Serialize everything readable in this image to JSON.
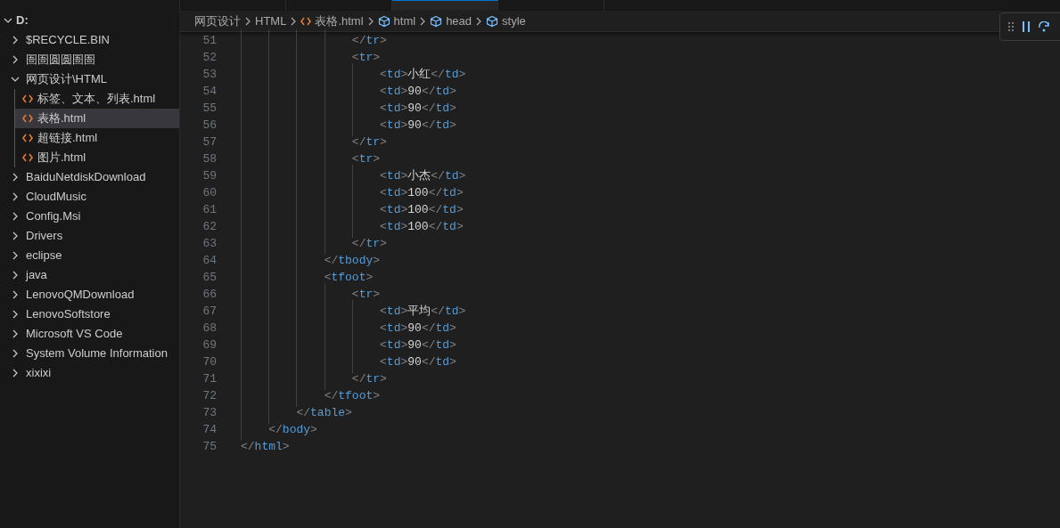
{
  "editor_tabs": [
    {
      "selected": false
    },
    {
      "selected": false
    },
    {
      "selected": true
    },
    {
      "selected": false
    }
  ],
  "explorer": {
    "root": "D:",
    "items": [
      {
        "label": "$RECYCLE.BIN",
        "kind": "folder",
        "expanded": false,
        "selected": false
      },
      {
        "label": "圄圄圆圆圄圄",
        "kind": "folder",
        "expanded": false,
        "selected": false
      },
      {
        "label": "网页设计\\HTML",
        "kind": "folder",
        "expanded": true,
        "selected": false,
        "children": [
          {
            "label": "标签、文本、列表.html",
            "kind": "file",
            "selected": false
          },
          {
            "label": "表格.html",
            "kind": "file",
            "selected": true
          },
          {
            "label": "超链接.html",
            "kind": "file",
            "selected": false
          },
          {
            "label": "图片.html",
            "kind": "file",
            "selected": false
          }
        ]
      },
      {
        "label": "BaiduNetdiskDownload",
        "kind": "folder",
        "expanded": false,
        "selected": false
      },
      {
        "label": "CloudMusic",
        "kind": "folder",
        "expanded": false,
        "selected": false
      },
      {
        "label": "Config.Msi",
        "kind": "folder",
        "expanded": false,
        "selected": false
      },
      {
        "label": "Drivers",
        "kind": "folder",
        "expanded": false,
        "selected": false
      },
      {
        "label": "eclipse",
        "kind": "folder",
        "expanded": false,
        "selected": false
      },
      {
        "label": "java",
        "kind": "folder",
        "expanded": false,
        "selected": false
      },
      {
        "label": "LenovoQMDownload",
        "kind": "folder",
        "expanded": false,
        "selected": false
      },
      {
        "label": "LenovoSoftstore",
        "kind": "folder",
        "expanded": false,
        "selected": false
      },
      {
        "label": "Microsoft VS Code",
        "kind": "folder",
        "expanded": false,
        "selected": false
      },
      {
        "label": "System Volume Information",
        "kind": "folder",
        "expanded": false,
        "selected": false
      },
      {
        "label": "xixixi",
        "kind": "folder",
        "expanded": false,
        "selected": false
      }
    ]
  },
  "breadcrumb": [
    {
      "label": "网页设计",
      "kind": "folder"
    },
    {
      "label": "HTML",
      "kind": "folder"
    },
    {
      "label": "表格.html",
      "kind": "file"
    },
    {
      "label": "html",
      "kind": "element"
    },
    {
      "label": "head",
      "kind": "element"
    },
    {
      "label": "style",
      "kind": "element"
    }
  ],
  "code_lines": [
    {
      "number": "51",
      "text": "                </tr>"
    },
    {
      "number": "52",
      "text": "                <tr>"
    },
    {
      "number": "53",
      "text": "                    <td>小红</td>"
    },
    {
      "number": "54",
      "text": "                    <td>90</td>"
    },
    {
      "number": "55",
      "text": "                    <td>90</td>"
    },
    {
      "number": "56",
      "text": "                    <td>90</td>"
    },
    {
      "number": "57",
      "text": "                </tr>"
    },
    {
      "number": "58",
      "text": "                <tr>"
    },
    {
      "number": "59",
      "text": "                    <td>小杰</td>"
    },
    {
      "number": "60",
      "text": "                    <td>100</td>"
    },
    {
      "number": "61",
      "text": "                    <td>100</td>"
    },
    {
      "number": "62",
      "text": "                    <td>100</td>"
    },
    {
      "number": "63",
      "text": "                </tr>"
    },
    {
      "number": "64",
      "text": "            </tbody>"
    },
    {
      "number": "65",
      "text": "            <tfoot>"
    },
    {
      "number": "66",
      "text": "                <tr>"
    },
    {
      "number": "67",
      "text": "                    <td>平均</td>"
    },
    {
      "number": "68",
      "text": "                    <td>90</td>"
    },
    {
      "number": "69",
      "text": "                    <td>90</td>"
    },
    {
      "number": "70",
      "text": "                    <td>90</td>"
    },
    {
      "number": "71",
      "text": "                </tr>"
    },
    {
      "number": "72",
      "text": "            </tfoot>"
    },
    {
      "number": "73",
      "text": "        </table>"
    },
    {
      "number": "74",
      "text": "    </body>"
    },
    {
      "number": "75",
      "text": "</html>"
    }
  ]
}
